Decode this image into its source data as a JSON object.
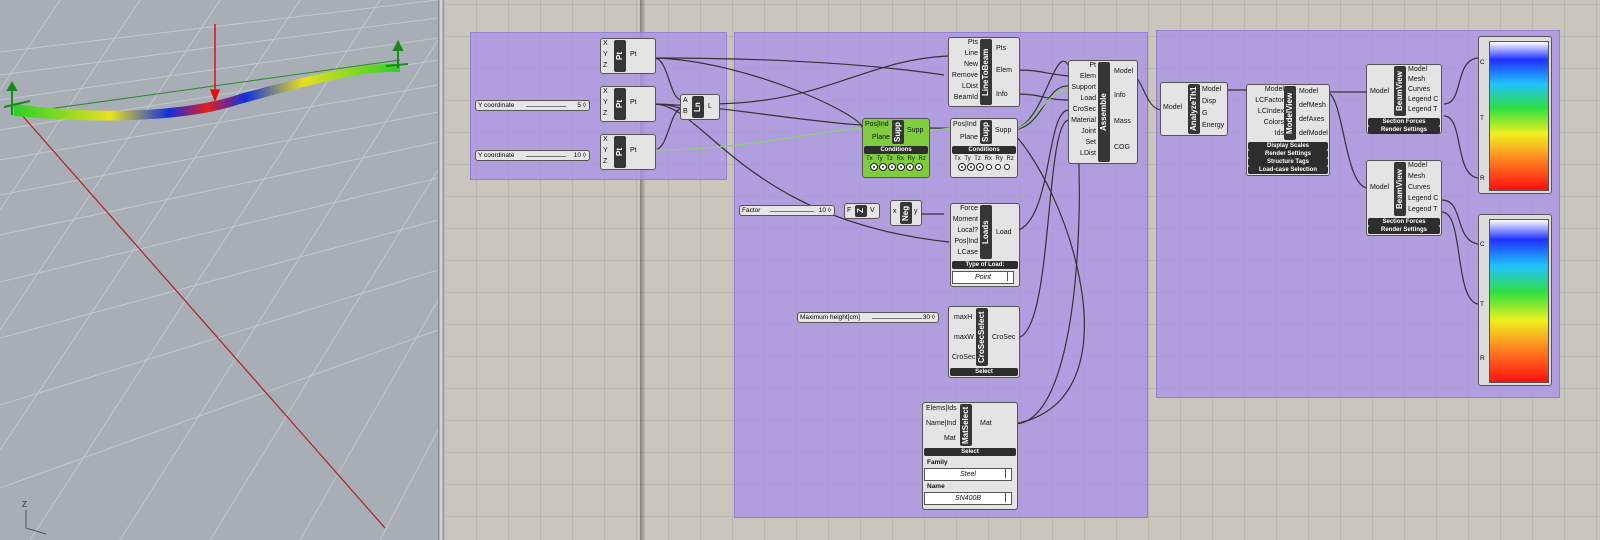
{
  "viewport": {
    "axis_label": "Z",
    "colors": {
      "beam_a": "#2bd02b",
      "beam_b": "#1030e0",
      "load_arrow": "#e01010",
      "support": "#1a8a1a",
      "grid": "#bfc4ca",
      "x_axis": "#b22222"
    }
  },
  "sliders": {
    "y1": {
      "label": "Y coordinate",
      "value": "5 ◊"
    },
    "y2": {
      "label": "Y coordinate",
      "value": "10 ◊"
    },
    "factor": {
      "label": "Factor",
      "value": "10 ◊"
    },
    "maxh": {
      "label": "Maximum height[cm]",
      "value": "30 ◊"
    }
  },
  "pt1": {
    "inputs": [
      "X",
      "Y",
      "Z"
    ],
    "name": "Pt",
    "outputs": [
      "Pt"
    ]
  },
  "pt2": {
    "inputs": [
      "X",
      "Y",
      "Z"
    ],
    "name": "Pt",
    "outputs": [
      "Pt"
    ]
  },
  "pt3": {
    "inputs": [
      "X",
      "Y",
      "Z"
    ],
    "name": "Pt",
    "outputs": [
      "Pt"
    ]
  },
  "ln": {
    "inputs": [
      "A",
      "B"
    ],
    "name": "Ln",
    "outputs": [
      "L"
    ]
  },
  "linetobeam": {
    "inputs": [
      "Pts",
      "Line",
      "New",
      "Remove",
      "LDist",
      "BeamId"
    ],
    "name": "LineToBeam",
    "outputs": [
      "Pts",
      "Elem",
      "Info"
    ]
  },
  "supp1": {
    "inputs": [
      "Pos|Ind",
      "Plane"
    ],
    "name": "Supp",
    "outputs": [
      "Supp"
    ],
    "bar": "Conditions",
    "dofs": "Tx Ty Tz Rx Ry Rz"
  },
  "supp2": {
    "inputs": [
      "Pos|Ind",
      "Plane"
    ],
    "name": "Supp",
    "outputs": [
      "Supp"
    ],
    "bar": "Conditions",
    "dofs": "Tx Ty Tz Rx Ry Rz"
  },
  "z": {
    "inputs": [
      "F"
    ],
    "name": "Z",
    "outputs": [
      "V"
    ]
  },
  "neg": {
    "inputs": [
      "x"
    ],
    "name": "Neg",
    "outputs": [
      "y"
    ]
  },
  "loads": {
    "inputs": [
      "Force",
      "Moment",
      "Local?",
      "Pos|Ind",
      "LCase"
    ],
    "name": "Loads",
    "outputs": [
      "Load"
    ],
    "bar": "Type of Load:",
    "value": "Point"
  },
  "crosec": {
    "inputs": [
      "maxH",
      "maxW",
      "CroSec"
    ],
    "name": "CroSecSelect",
    "outputs": [
      "CroSec"
    ],
    "bar": "Select"
  },
  "matsel": {
    "inputs": [
      "Elems|Ids",
      "Name|Ind",
      "Mat"
    ],
    "name": "MatSelect",
    "outputs": [
      "Mat"
    ],
    "bar": "Select",
    "family_label": "Family",
    "family_value": "Steel",
    "name_label": "Name",
    "name_value": "SN400B"
  },
  "assemble": {
    "inputs": [
      "Pt",
      "Elem",
      "Support",
      "Load",
      "CroSec",
      "Material",
      "Joint",
      "Set",
      "LDist"
    ],
    "name": "Assemble",
    "outputs": [
      "Model",
      "Info",
      "Mass",
      "COG"
    ]
  },
  "analyze": {
    "inputs": [
      "Model"
    ],
    "name": "AnalyzeTh1",
    "outputs": [
      "Model",
      "Disp",
      "G",
      "Energy"
    ]
  },
  "modelview": {
    "inputs": [
      "Model",
      "LCFactor",
      "LCIndex",
      "Colors",
      "Ids"
    ],
    "name": "ModelView",
    "outputs": [
      "Model",
      "defMesh",
      "defAxes",
      "defModel"
    ],
    "bars": [
      "Display Scales",
      "Render Settings",
      "Structure Tags",
      "Load-case Selection"
    ]
  },
  "beamview1": {
    "inputs": [
      "Model"
    ],
    "name": "BeamView",
    "outputs": [
      "Model",
      "Mesh",
      "Curves",
      "Legend C",
      "Legend T"
    ],
    "bars": [
      "Section Forces",
      "Render Settings"
    ]
  },
  "beamview2": {
    "inputs": [
      "Model"
    ],
    "name": "BeamView",
    "outputs": [
      "Model",
      "Mesh",
      "Curves",
      "Legend C",
      "Legend T"
    ],
    "bars": [
      "Section Forces",
      "Render Settings"
    ]
  },
  "legend1": {
    "labels": [
      "C",
      "T",
      "R"
    ]
  },
  "legend2": {
    "labels": [
      "C",
      "T",
      "R"
    ]
  }
}
